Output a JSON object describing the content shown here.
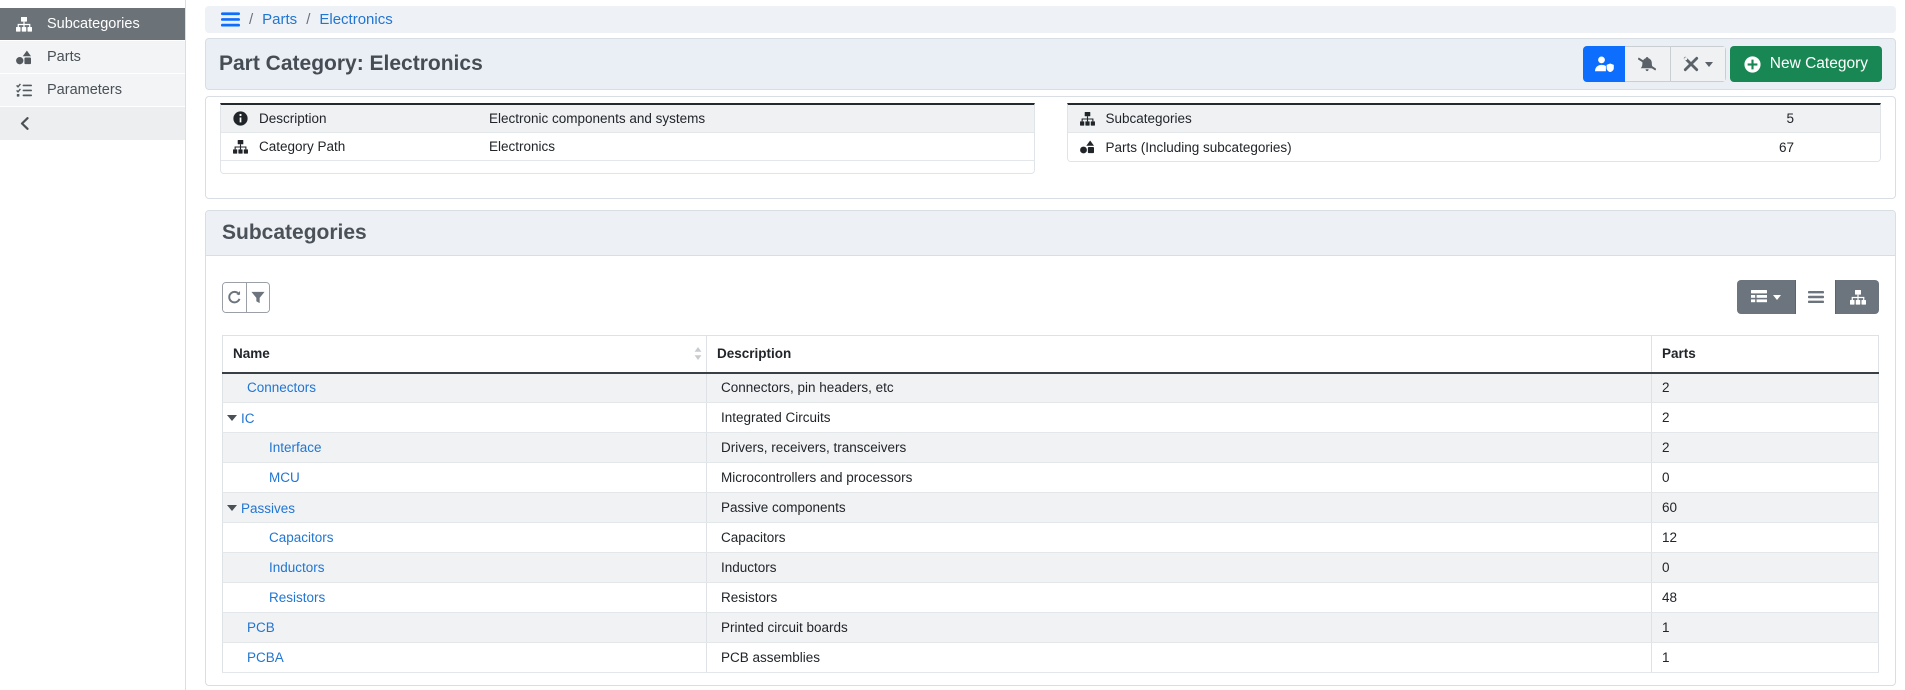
{
  "colors": {
    "accent_blue": "#0d6efd",
    "link_blue": "#2176d2",
    "success_green": "#198754",
    "secondary_gray": "#6c757d",
    "active_sidebar": "#6b7278"
  },
  "sidebar": {
    "items": [
      {
        "label": "Subcategories",
        "icon": "sitemap-icon",
        "active": true
      },
      {
        "label": "Parts",
        "icon": "shapes-icon",
        "active": false
      },
      {
        "label": "Parameters",
        "icon": "list-check-icon",
        "active": false
      }
    ]
  },
  "breadcrumb": {
    "separator": "/",
    "items": [
      "Parts",
      "Electronics"
    ]
  },
  "header": {
    "title": "Part Category: Electronics",
    "buttons": {
      "new_category_label": "New Category"
    }
  },
  "info": {
    "left": {
      "rows": [
        {
          "icon": "info-circle-icon",
          "label": "Description",
          "value": "Electronic components and systems"
        },
        {
          "icon": "sitemap-icon",
          "label": "Category Path",
          "value": "Electronics"
        }
      ]
    },
    "right": {
      "rows": [
        {
          "icon": "sitemap-icon",
          "label": "Subcategories",
          "value": "5"
        },
        {
          "icon": "shapes-icon",
          "label": "Parts (Including subcategories)",
          "value": "67"
        }
      ]
    }
  },
  "panel": {
    "title": "Subcategories",
    "table": {
      "columns": [
        "Name",
        "Description",
        "Parts"
      ],
      "rows": [
        {
          "name": "Connectors",
          "description": "Connectors, pin headers, etc",
          "parts": "2",
          "level": 1,
          "expandable": false
        },
        {
          "name": "IC",
          "description": "Integrated Circuits",
          "parts": "2",
          "level": 1,
          "expandable": true
        },
        {
          "name": "Interface",
          "description": "Drivers, receivers, transceivers",
          "parts": "2",
          "level": 2,
          "expandable": false
        },
        {
          "name": "MCU",
          "description": "Microcontrollers and processors",
          "parts": "0",
          "level": 2,
          "expandable": false
        },
        {
          "name": "Passives",
          "description": "Passive components",
          "parts": "60",
          "level": 1,
          "expandable": true
        },
        {
          "name": "Capacitors",
          "description": "Capacitors",
          "parts": "12",
          "level": 2,
          "expandable": false
        },
        {
          "name": "Inductors",
          "description": "Inductors",
          "parts": "0",
          "level": 2,
          "expandable": false
        },
        {
          "name": "Resistors",
          "description": "Resistors",
          "parts": "48",
          "level": 2,
          "expandable": false
        },
        {
          "name": "PCB",
          "description": "Printed circuit boards",
          "parts": "1",
          "level": 1,
          "expandable": false
        },
        {
          "name": "PCBA",
          "description": "PCB assemblies",
          "parts": "1",
          "level": 1,
          "expandable": false
        }
      ]
    }
  }
}
